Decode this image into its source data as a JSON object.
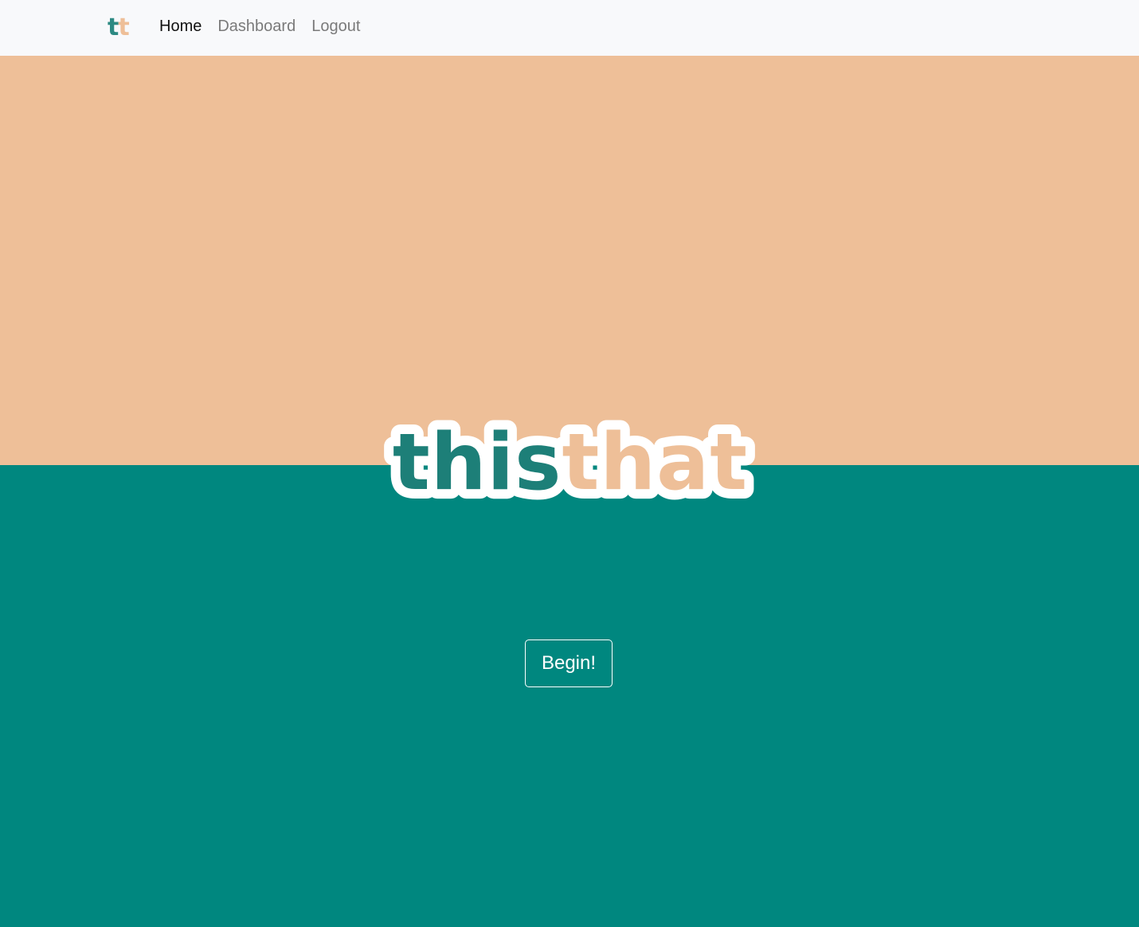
{
  "navbar": {
    "brand": {
      "letter_1": "t",
      "letter_2": "t"
    },
    "links": [
      {
        "label": "Home",
        "active": true
      },
      {
        "label": "Dashboard",
        "active": false
      },
      {
        "label": "Logout",
        "active": false
      }
    ]
  },
  "hero": {
    "logo": {
      "part_1": "this",
      "part_2": "that"
    },
    "cta_label": "Begin!"
  },
  "colors": {
    "navbar_bg": "#f8f9fb",
    "peach": "#eebf98",
    "teal": "#00877f",
    "logo_teal": "#1d7f78",
    "logo_outline": "#ffffff"
  }
}
